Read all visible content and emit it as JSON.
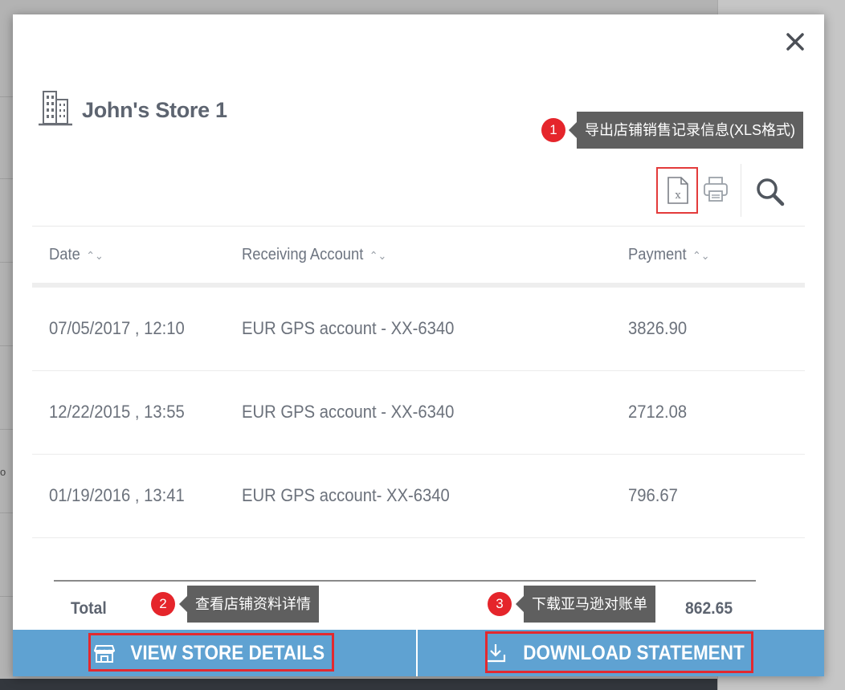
{
  "background": {
    "edge_text": "o"
  },
  "modal": {
    "title": "John's Store 1",
    "close_icon": "close-icon"
  },
  "annotations": [
    {
      "number": "1",
      "text": "导出店铺销售记录信息(XLS格式)"
    },
    {
      "number": "2",
      "text": "查看店铺资料详情"
    },
    {
      "number": "3",
      "text": "下载亚马逊对账单"
    }
  ],
  "toolbar": {
    "icons": [
      "xls-file-icon",
      "print-icon",
      "search-icon"
    ]
  },
  "table": {
    "headers": {
      "date": "Date",
      "account": "Receiving Account",
      "payment": "Payment",
      "sort_glyph": "⌃⌄"
    },
    "rows": [
      {
        "date": "07/05/2017 , 12:10",
        "account": "EUR GPS account - XX-6340",
        "payment": "3826.90"
      },
      {
        "date": "12/22/2015 , 13:55",
        "account": "EUR GPS account - XX-6340",
        "payment": "2712.08"
      },
      {
        "date": "01/19/2016 , 13:41",
        "account": "EUR GPS account- XX-6340",
        "payment": "796.67"
      }
    ],
    "total_label": "Total",
    "total_value": "862.65"
  },
  "footer": {
    "view_store_label": "VIEW STORE DETAILS",
    "download_label": "DOWNLOAD STATEMENT"
  },
  "colors": {
    "accent": "#5fa2d2",
    "highlight": "#e3292f",
    "tooltip": "#5f5f5f"
  }
}
